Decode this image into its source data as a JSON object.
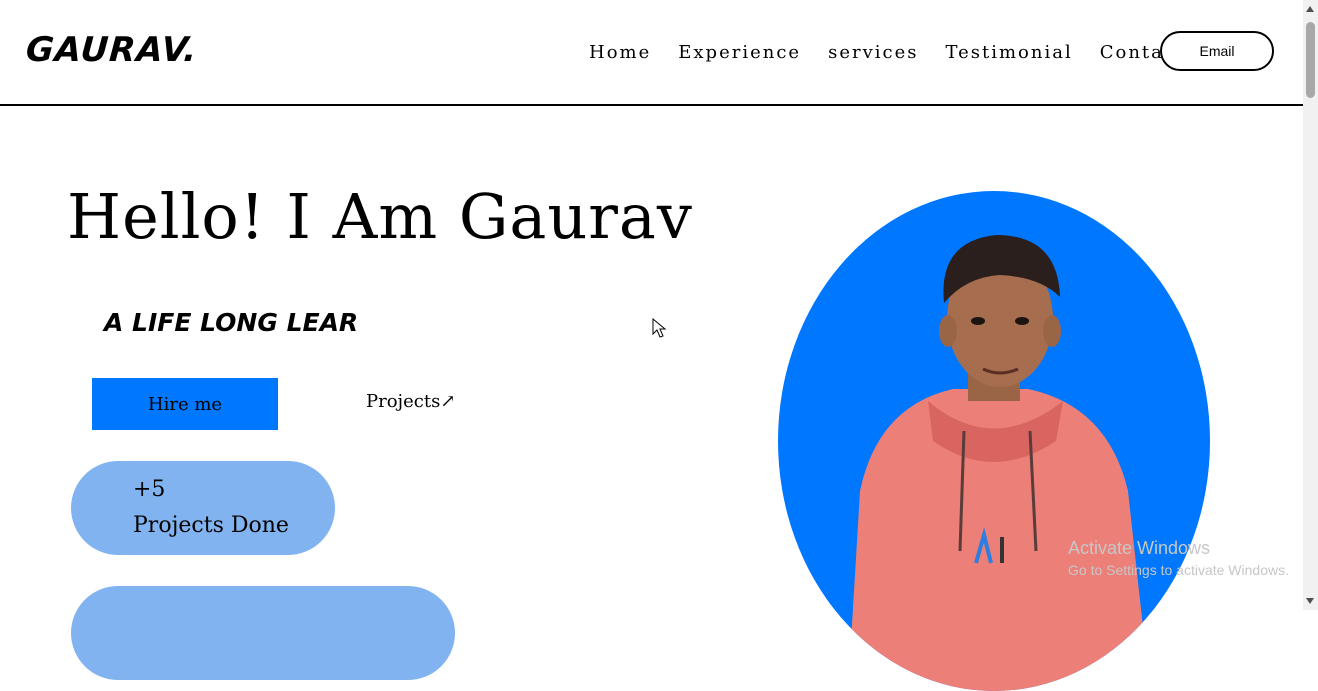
{
  "header": {
    "logo": "GAURAV.",
    "nav": [
      "Home",
      "Experience",
      "services",
      "Testimonial",
      "Contact"
    ],
    "email_label": "Email"
  },
  "hero": {
    "title": "Hello! I Am Gaurav",
    "tagline": "A LIFE LONG LEAR",
    "hire_label": "Hire me",
    "projects_label": "Projects↗",
    "stats": [
      {
        "number": "+5",
        "label": "Projects Done"
      },
      {
        "number": "",
        "label": ""
      }
    ]
  },
  "watermark": {
    "line1": "Activate Windows",
    "line2": "Go to Settings to activate Windows."
  },
  "colors": {
    "accent_blue": "#0077ff",
    "stat_bg": "#80b3ef"
  },
  "icons": {
    "cursor": "mouse-pointer-icon",
    "scroll_up": "scroll-up-arrow-icon",
    "scroll_down": "scroll-down-arrow-icon"
  }
}
